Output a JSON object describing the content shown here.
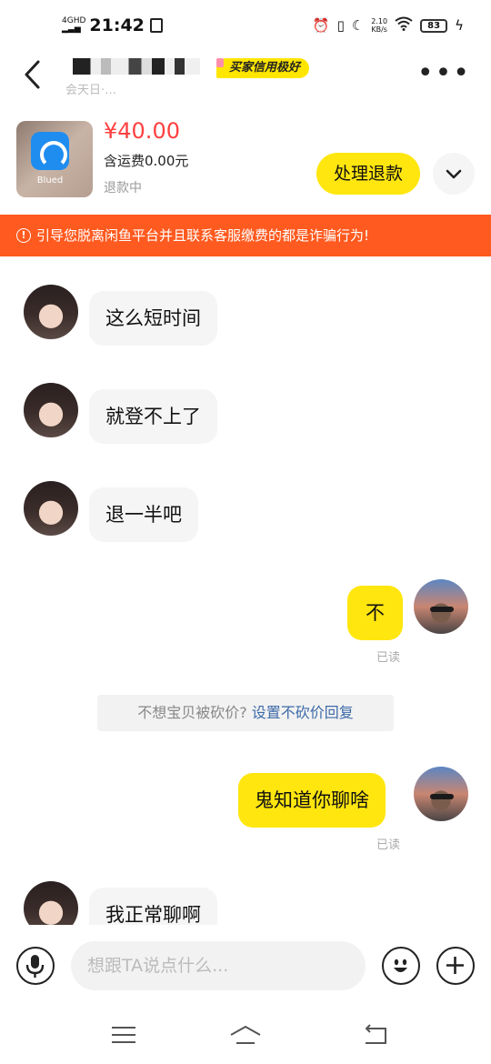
{
  "status_bar": {
    "network": "4GHD",
    "time": "21:42",
    "speed_value": "2.10",
    "speed_unit": "KB/s",
    "battery": "83"
  },
  "header": {
    "contact_sub": "会天日·…",
    "credit_badge": "买家信用极好"
  },
  "product": {
    "price": "¥40.00",
    "shipping": "含运费0.00元",
    "status": "退款中",
    "logo_label": "Blued",
    "refund_button": "处理退款"
  },
  "warning": {
    "text": "引导您脱离闲鱼平台并且联系客服缴费的都是诈骗行为!"
  },
  "chat": {
    "messages": [
      {
        "side": "in",
        "text": "这么短时间"
      },
      {
        "side": "in",
        "text": "就登不上了"
      },
      {
        "side": "in",
        "text": "退一半吧"
      },
      {
        "side": "out",
        "text": "不",
        "read": "已读"
      },
      {
        "side": "out",
        "text": "鬼知道你聊啥",
        "read": "已读"
      },
      {
        "side": "in",
        "text": "我正常聊啊"
      }
    ],
    "system_tip": {
      "text": "不想宝贝被砍价?",
      "link": "设置不砍价回复"
    }
  },
  "input": {
    "placeholder": "想跟TA说点什么..."
  },
  "colors": {
    "accent_yellow": "#ffe60f",
    "warning_orange": "#ff5a1f",
    "price_red": "#ff4040"
  }
}
